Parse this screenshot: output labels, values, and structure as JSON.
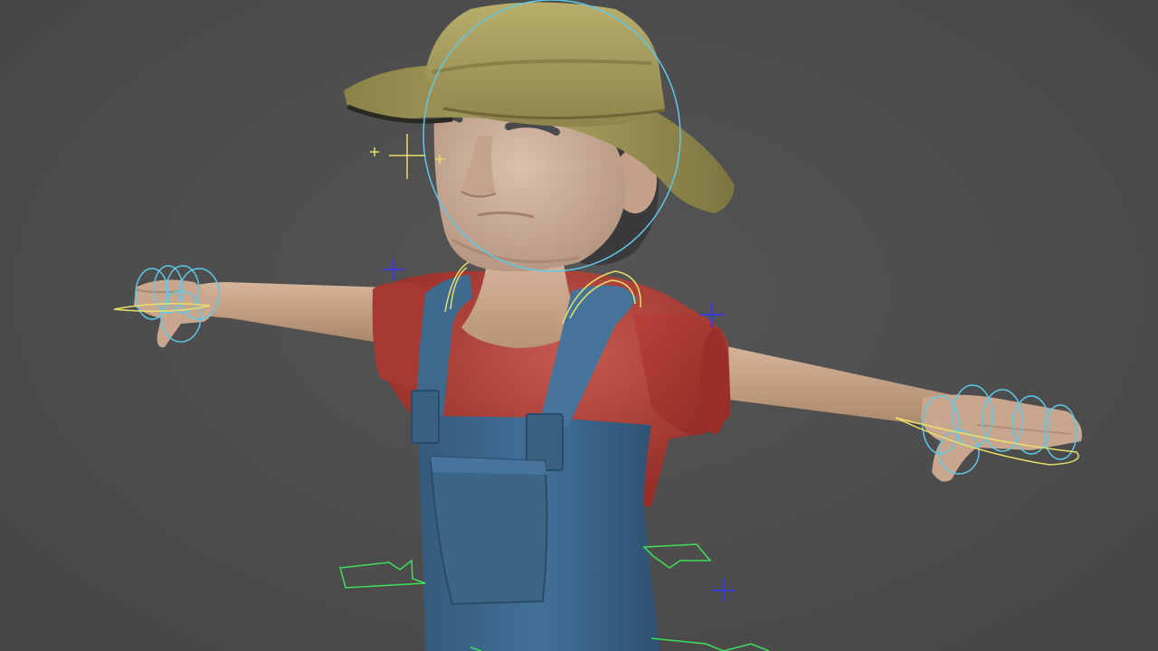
{
  "viewport": {
    "background_color": "#4d4d4d",
    "character": "farmer-rigged-model",
    "pose": "t-pose"
  },
  "colors": {
    "skin": "#c9a68e",
    "hat": "#a49a5c",
    "shirt": "#a8362f",
    "overalls": "#3f6a8e",
    "hair": "#3a3a3c",
    "ik_control": "#5ec8e8",
    "fk_control": "#e8df6a",
    "foot_control": "#3fe05a",
    "pole_vector": "#3b3bd6"
  },
  "rig_controls": [
    {
      "name": "head-control",
      "shape": "circle",
      "color": "ik_control"
    },
    {
      "name": "left-hand-finger-controls",
      "shape": "circles",
      "color": "ik_control"
    },
    {
      "name": "right-hand-finger-controls",
      "shape": "circles",
      "color": "ik_control"
    },
    {
      "name": "shoulder-controls",
      "shape": "arcs",
      "color": "fk_control"
    },
    {
      "name": "eye-aim-control",
      "shape": "cross",
      "color": "fk_control"
    },
    {
      "name": "elbow-pole-vectors",
      "shape": "cross",
      "color": "pole_vector"
    },
    {
      "name": "foot-controls",
      "shape": "arrow",
      "color": "foot_control"
    }
  ]
}
